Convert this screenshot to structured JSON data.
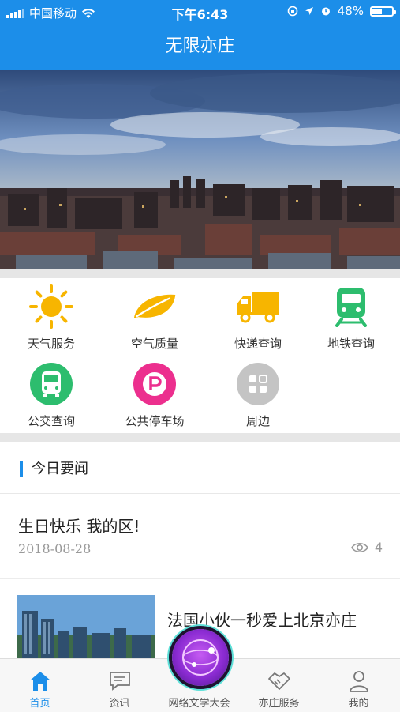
{
  "status_bar": {
    "carrier": "中国移动",
    "time": "下午6:43",
    "battery_percent": "48%",
    "battery_level": 0.48
  },
  "navbar": {
    "title": "无限亦庄"
  },
  "services": [
    {
      "label": "天气服务",
      "icon": "sun-icon",
      "color": "#f7b500"
    },
    {
      "label": "空气质量",
      "icon": "leaf-icon",
      "color": "#f7b500"
    },
    {
      "label": "快递查询",
      "icon": "truck-icon",
      "color": "#f7b500"
    },
    {
      "label": "地铁查询",
      "icon": "subway-icon",
      "color": "#2dbd6e"
    },
    {
      "label": "公交查询",
      "icon": "bus-icon",
      "color": "#2dbd6e"
    },
    {
      "label": "公共停车场",
      "icon": "parking-icon",
      "color": "#ec2f8e"
    },
    {
      "label": "周边",
      "icon": "grid-icon",
      "color": "#c4c4c4"
    }
  ],
  "news_section": {
    "title": "今日要闻"
  },
  "news": [
    {
      "title": "生日快乐 我的区!",
      "date": "2018-08-28",
      "views": "4"
    },
    {
      "title": "法国小伙一秒爱上北京亦庄"
    }
  ],
  "tabbar": {
    "items": [
      {
        "label": "首页",
        "icon": "home-icon"
      },
      {
        "label": "资讯",
        "icon": "chat-icon"
      },
      {
        "label": "网络文学大会",
        "icon": "globe-icon"
      },
      {
        "label": "亦庄服务",
        "icon": "handshake-icon"
      },
      {
        "label": "我的",
        "icon": "user-icon"
      }
    ],
    "active_color": "#1c8ee9"
  }
}
